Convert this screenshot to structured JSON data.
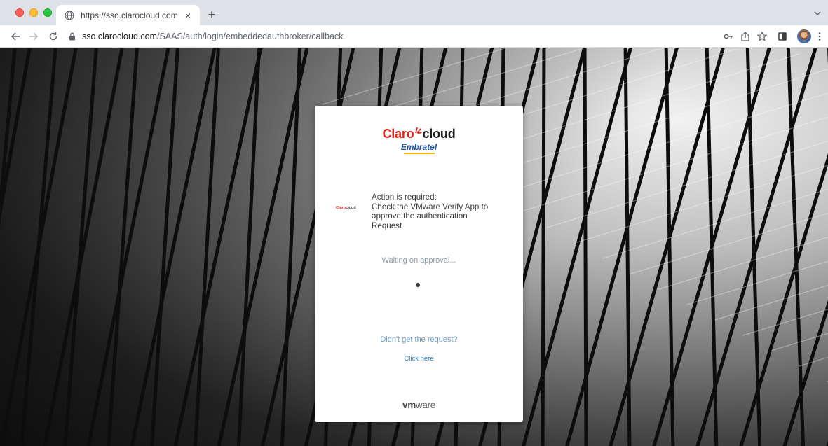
{
  "browser": {
    "tab_title": "https://sso.clarocloud.com/SAAS",
    "tab_close_glyph": "×",
    "new_tab_glyph": "+",
    "url_host": "sso.clarocloud.com",
    "url_path": "/SAAS/auth/login/embeddedauthbroker/callback",
    "icons": [
      "globe-icon",
      "lock-icon",
      "key-icon",
      "share-icon",
      "star-icon",
      "sidepanel-icon",
      "menu-icon"
    ]
  },
  "card": {
    "brand": {
      "claro": "Claro",
      "cloud": "cloud",
      "sub": "Embratel"
    },
    "notice": {
      "mini_logo_claro": "Claro",
      "mini_logo_cloud": "cloud",
      "lines": [
        "Action is required:",
        "Check the VMware Verify App to",
        "approve the authentication",
        "Request"
      ]
    },
    "status": "Waiting on approval...",
    "help_text": "Didn't get the request?",
    "help_link": "Click here",
    "footer": {
      "vm": "vm",
      "ware": "ware"
    }
  },
  "colors": {
    "claro_red": "#e3261b",
    "embratel_blue": "#1b4fa2",
    "link_blue": "#2f7fbd"
  }
}
